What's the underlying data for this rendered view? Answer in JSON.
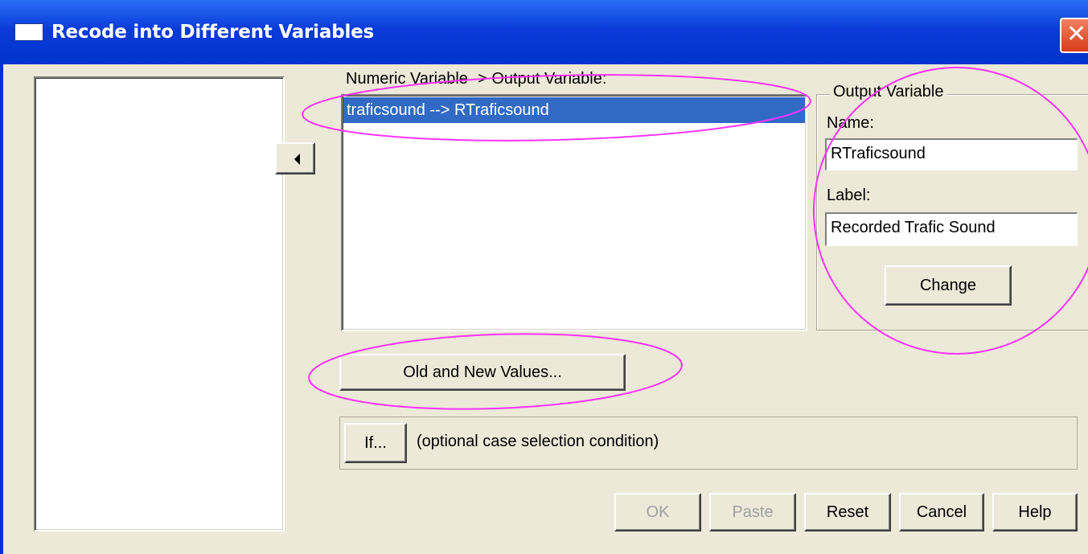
{
  "window": {
    "title": "Recode into Different Variables",
    "close_symbol": "✕"
  },
  "variable_list": {
    "items": []
  },
  "move_button": {
    "icon": "left-arrow-icon"
  },
  "mapping": {
    "label": "Numeric Variable -> Output Variable:",
    "items": [
      "traficsound --> RTraficsound"
    ]
  },
  "output_variable": {
    "legend": "Output Variable",
    "name_label": "Name:",
    "name_value": "RTraficsound",
    "label_label": "Label:",
    "label_value": "Recorded Trafic Sound",
    "change_button": "Change"
  },
  "old_new_button": "Old and New Values...",
  "if_section": {
    "button": "If...",
    "text": "(optional case selection condition)"
  },
  "footer_buttons": {
    "ok": "OK",
    "paste": "Paste",
    "reset": "Reset",
    "cancel": "Cancel",
    "help": "Help"
  },
  "colors": {
    "title_bar": "#0a3bd8",
    "dialog_bg": "#ece9d8",
    "selection": "#316ac5",
    "annotation": "#ff33ff"
  }
}
